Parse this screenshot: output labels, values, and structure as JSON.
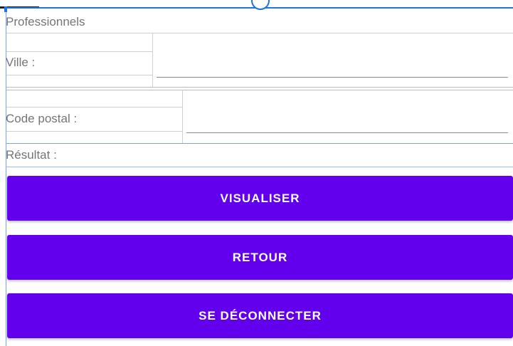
{
  "form": {
    "title": "Professionnels",
    "city_label": "Ville :",
    "city_value": "",
    "postal_label": "Code postal :",
    "postal_value": "",
    "result_label": "Résultat :"
  },
  "buttons": {
    "view": "VISUALISER",
    "back": "RETOUR",
    "logout": "SE DÉCONNECTER"
  },
  "colors": {
    "button_bg": "#6200ee",
    "selection_frame": "#1e73e8"
  }
}
